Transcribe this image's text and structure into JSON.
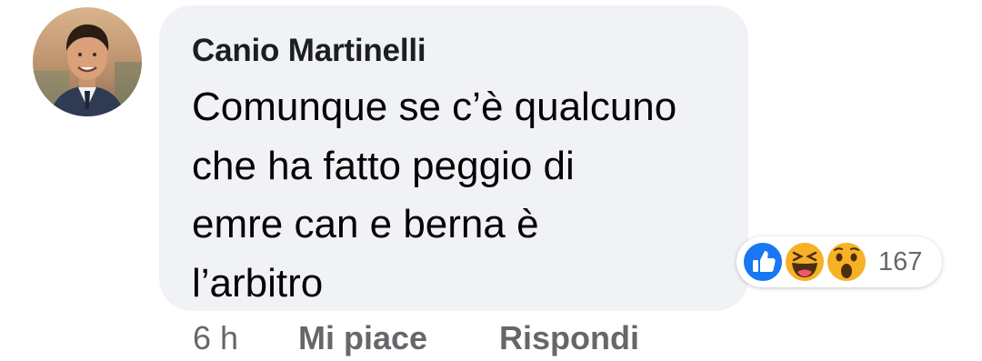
{
  "comment": {
    "author": "Canio Martinelli",
    "lines": [
      "Comunque se c’è qualcuno",
      "che ha fatto peggio di",
      "emre can e berna è",
      "l’arbitro"
    ]
  },
  "reactions": {
    "icons": [
      "like-icon",
      "haha-icon",
      "wow-icon"
    ],
    "count": "167"
  },
  "actions": {
    "time": "6 h",
    "like_label": "Mi piace",
    "reply_label": "Rispondi"
  },
  "colors": {
    "bubble": "#f0f2f5",
    "like_blue": "#1877f2",
    "emoji_yellow": "#f7b125",
    "secondary_text": "#65676b"
  }
}
